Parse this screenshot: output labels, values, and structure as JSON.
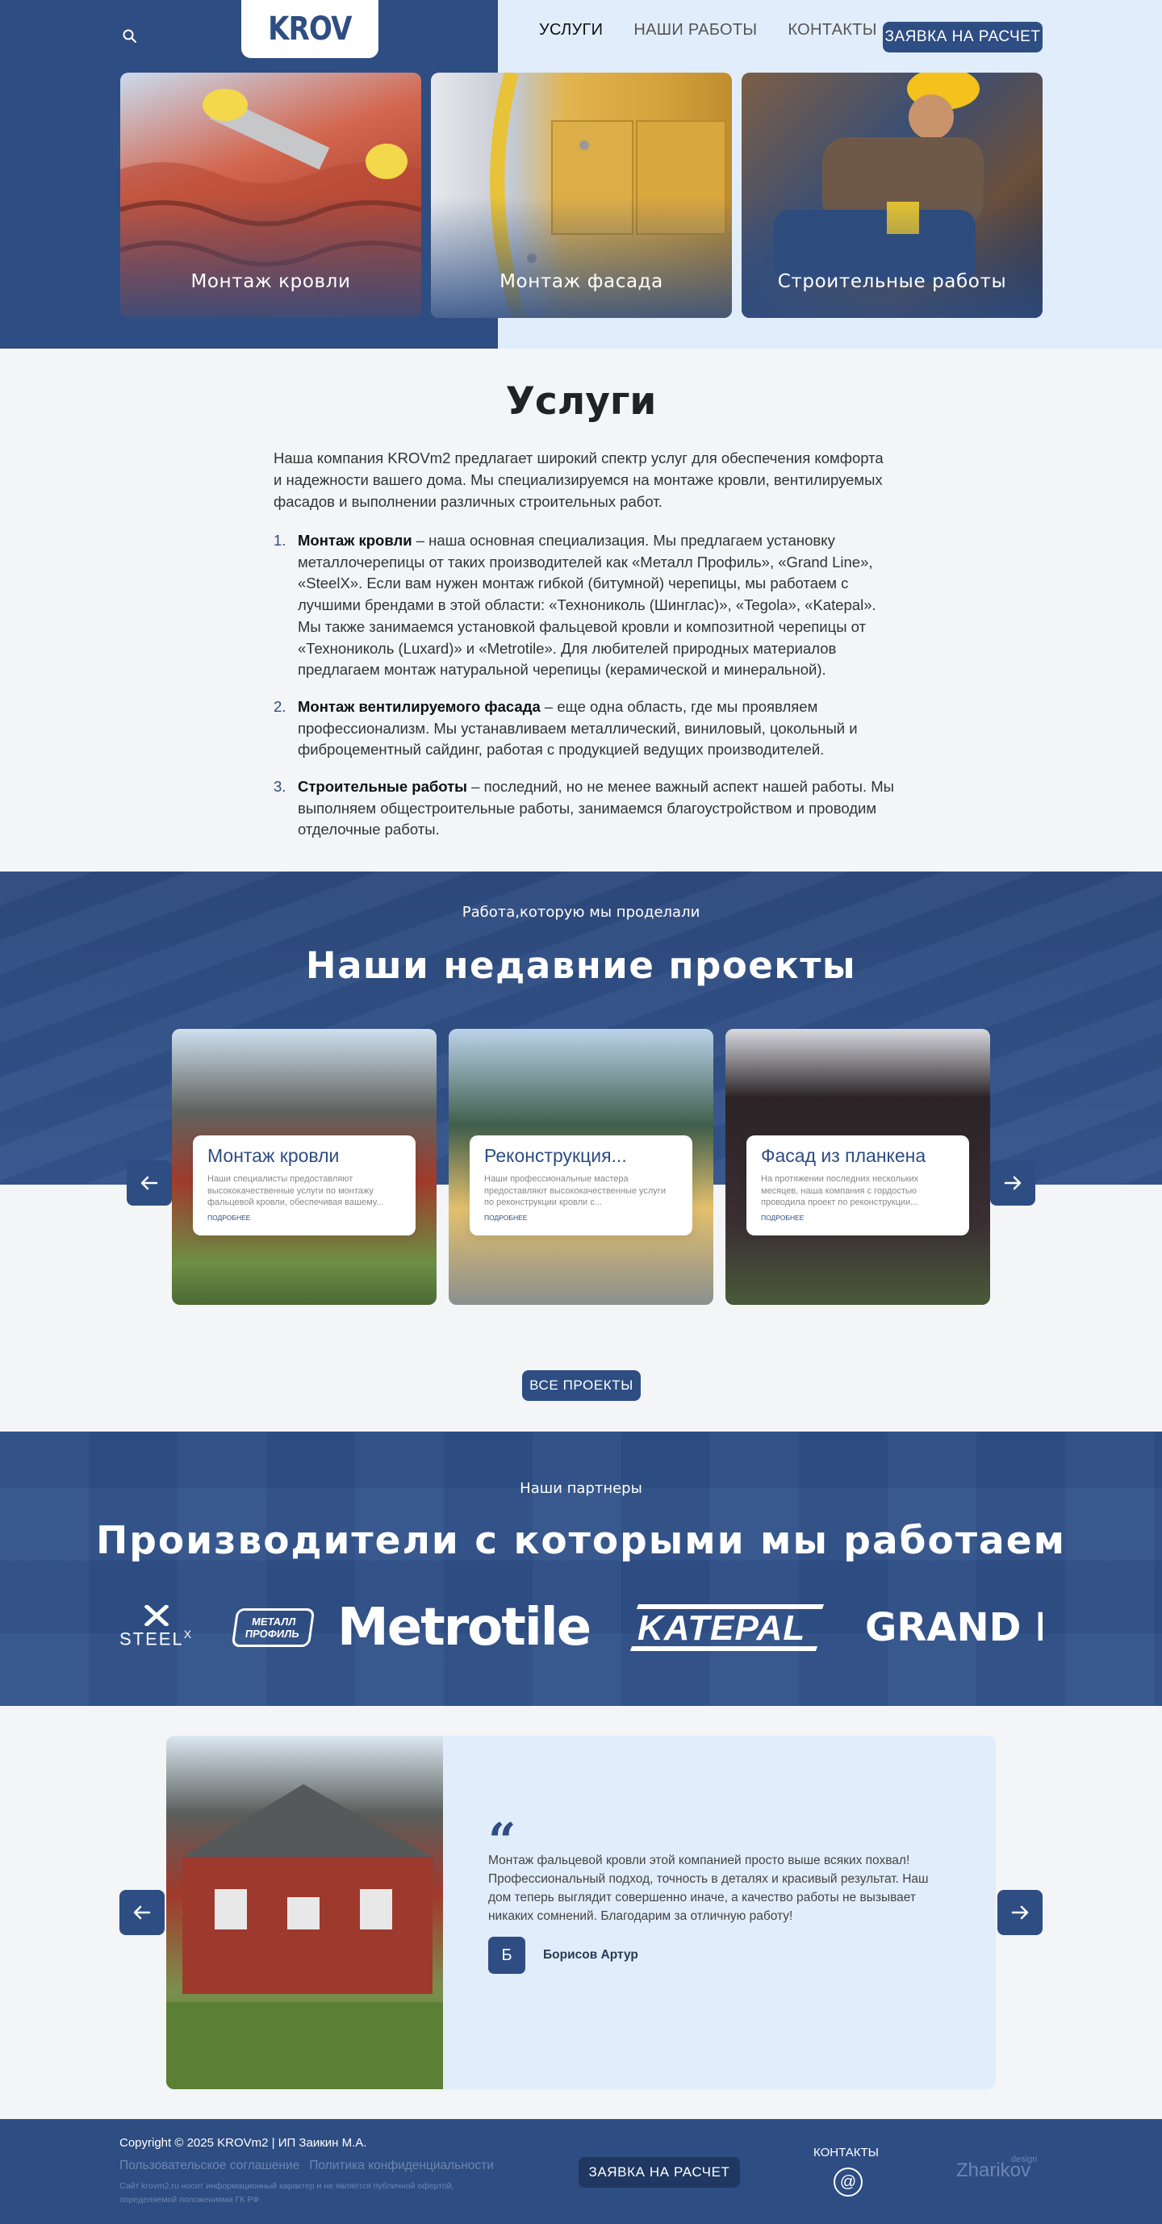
{
  "header": {
    "logo": "KROV",
    "nav": [
      {
        "label": "Услуги"
      },
      {
        "label": "Наши работы"
      },
      {
        "label": "Контакты"
      }
    ],
    "cta": "Заявка на расчет"
  },
  "hero_cards": [
    {
      "label": "Монтаж кровли"
    },
    {
      "label": "Монтаж фасада"
    },
    {
      "label": "Строительные работы"
    }
  ],
  "services": {
    "title": "Услуги",
    "intro": "Наша компания KROVm2 предлагает широкий спектр услуг для обеспечения комфорта и надежности вашего дома. Мы специализируемся на монтаже кровли, вентилируемых фасадов и выполнении различных строительных работ.",
    "items": [
      {
        "num": "1.",
        "bold": "Монтаж кровли",
        "text": " – наша основная специализация. Мы предлагаем установку металлочерепицы от таких производителей как «Металл Профиль», «Grand Line», «SteelX». Если вам нужен монтаж гибкой (битумной) черепицы, мы работаем с лучшими брендами в этой области: «Технониколь (Шинглас)», «Tegola», «Katepal». Мы также занимаемся установкой фальцевой кровли и композитной черепицы от «Технониколь (Luxard)» и «Metrotile». Для любителей природных материалов предлагаем монтаж натуральной черепицы (керамической и минеральной)."
      },
      {
        "num": "2.",
        "bold": "Монтаж вентилируемого фасада",
        "text": " – еще одна область, где мы проявляем профессионализм. Мы устанавливаем металлический, виниловый, цокольный и фиброцементный сайдинг, работая с продукцией ведущих производителей."
      },
      {
        "num": "3.",
        "bold": "Строительные работы",
        "text": " – последний, но не менее важный аспект нашей работы. Мы выполняем общестроительные работы, занимаемся благоустройством и проводим отделочные работы."
      }
    ]
  },
  "projects": {
    "kicker": "Работа,которую мы проделали",
    "title": "Наши недавние проекты",
    "cards": [
      {
        "title": "Монтаж кровли",
        "text": "Наши специалисты предоставляют высококачественные услуги по монтажу фальцевой кровли, обеспечивая вашему...",
        "more": "подробнее"
      },
      {
        "title": "Реконструкция...",
        "text": "Наши профессиональные мастера предоставляют высококачественные услуги по реконструкции кровли с...",
        "more": "подробнее"
      },
      {
        "title": "Фасад из планкена",
        "text": "На протяжении последних нескольких месяцев, наша компания с гордостью проводила проект по реконструкции...",
        "more": "подробнее"
      }
    ],
    "all_button": "Все проекты"
  },
  "partners": {
    "kicker": "Наши партнеры",
    "title": "Производители с которыми мы работаем",
    "logos": [
      {
        "name": "SteelX",
        "text": "STEEL",
        "sup": "X"
      },
      {
        "name": "Металл Профиль",
        "line1": "МЕТАЛЛ",
        "line2": "ПРОФИЛЬ"
      },
      {
        "name": "Metrotile",
        "text": "Metrotile"
      },
      {
        "name": "Katepal",
        "text": "KATEPAL"
      },
      {
        "name": "Grand Line",
        "text": "GRAND L"
      }
    ]
  },
  "review": {
    "text": "Монтаж фальцевой кровли этой компанией просто выше всяких похвал! Профессиональный подход, точность в деталях и красивый результат. Наш дом теперь выглядит совершенно иначе, а качество работы не вызывает никаких сомнений. Благодарим за отличную работу!",
    "avatar_letter": "Б",
    "author": "Борисов Артур"
  },
  "footer": {
    "copyright": "Copyright © 2025 KROVm2 | ИП Заикин М.А.",
    "links": [
      "Пользовательское соглашение",
      "Политика конфиденциальности"
    ],
    "note": "Сайт krovm2.ru носит информационный характер и не является публичной офертой, определяемой положениями ГК РФ.",
    "cta": "Заявка на расчет",
    "contacts": "Контакты",
    "at": "@",
    "brand": "Zharikov",
    "brand_small": "design"
  },
  "colors": {
    "primary": "#2e4d82",
    "light_bg": "#e1edfb",
    "page_bg": "#f4f5f7"
  }
}
